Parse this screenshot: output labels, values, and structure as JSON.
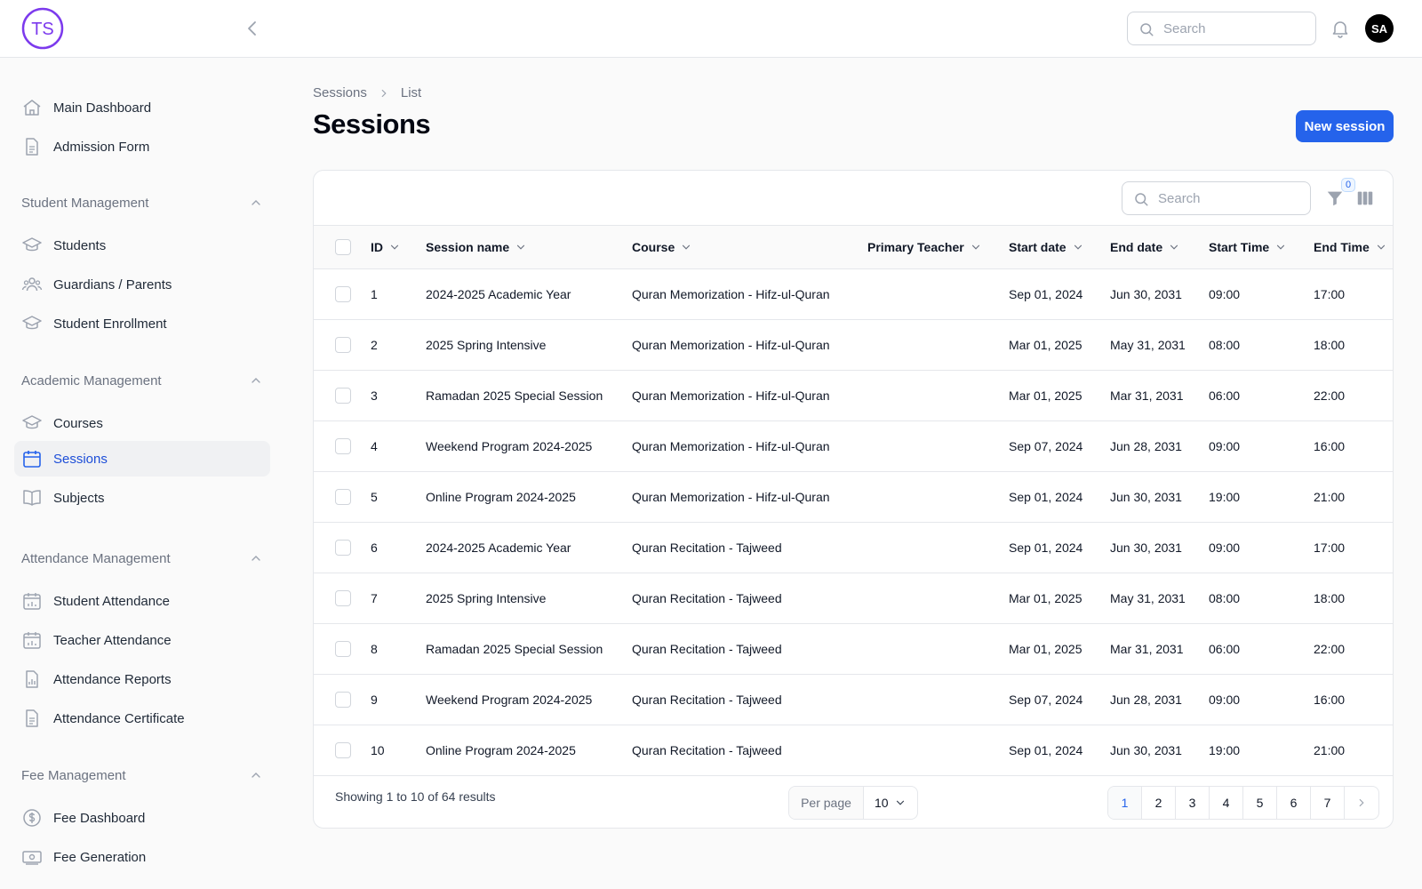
{
  "header": {
    "logo_text": "TS",
    "search_placeholder": "Search",
    "avatar_initials": "SA"
  },
  "sidebar": {
    "top_items": [
      {
        "label": "Main Dashboard",
        "icon": "home-icon"
      },
      {
        "label": "Admission Form",
        "icon": "document-icon"
      }
    ],
    "groups": [
      {
        "title": "Student Management",
        "items": [
          {
            "label": "Students",
            "icon": "graduation-cap-icon"
          },
          {
            "label": "Guardians / Parents",
            "icon": "users-icon"
          },
          {
            "label": "Student Enrollment",
            "icon": "graduation-cap-icon"
          }
        ]
      },
      {
        "title": "Academic Management",
        "items": [
          {
            "label": "Courses",
            "icon": "graduation-cap-icon"
          },
          {
            "label": "Sessions",
            "icon": "calendar-icon",
            "active": true
          },
          {
            "label": "Subjects",
            "icon": "book-icon"
          }
        ]
      },
      {
        "title": "Attendance Management",
        "items": [
          {
            "label": "Student Attendance",
            "icon": "calendar-chart-icon"
          },
          {
            "label": "Teacher Attendance",
            "icon": "calendar-chart-icon"
          },
          {
            "label": "Attendance Reports",
            "icon": "report-icon"
          },
          {
            "label": "Attendance Certificate",
            "icon": "document-icon"
          }
        ]
      },
      {
        "title": "Fee Management",
        "items": [
          {
            "label": "Fee Dashboard",
            "icon": "dollar-icon"
          },
          {
            "label": "Fee Generation",
            "icon": "banknote-icon"
          }
        ]
      }
    ]
  },
  "breadcrumb": {
    "root": "Sessions",
    "current": "List"
  },
  "page": {
    "title": "Sessions",
    "new_button": "New session"
  },
  "table_toolbar": {
    "search_placeholder": "Search",
    "filter_count": "0"
  },
  "table": {
    "columns": [
      "ID",
      "Session name",
      "Course",
      "Primary Teacher",
      "Start date",
      "End date",
      "Start Time",
      "End Time"
    ],
    "rows": [
      [
        "1",
        "2024-2025 Academic Year",
        "Quran Memorization - Hifz-ul-Quran",
        "",
        "Sep 01, 2024",
        "Jun 30, 2031",
        "09:00",
        "17:00"
      ],
      [
        "2",
        "2025 Spring Intensive",
        "Quran Memorization - Hifz-ul-Quran",
        "",
        "Mar 01, 2025",
        "May 31, 2031",
        "08:00",
        "18:00"
      ],
      [
        "3",
        "Ramadan 2025 Special Session",
        "Quran Memorization - Hifz-ul-Quran",
        "",
        "Mar 01, 2025",
        "Mar 31, 2031",
        "06:00",
        "22:00"
      ],
      [
        "4",
        "Weekend Program 2024-2025",
        "Quran Memorization - Hifz-ul-Quran",
        "",
        "Sep 07, 2024",
        "Jun 28, 2031",
        "09:00",
        "16:00"
      ],
      [
        "5",
        "Online Program 2024-2025",
        "Quran Memorization - Hifz-ul-Quran",
        "",
        "Sep 01, 2024",
        "Jun 30, 2031",
        "19:00",
        "21:00"
      ],
      [
        "6",
        "2024-2025 Academic Year",
        "Quran Recitation - Tajweed",
        "",
        "Sep 01, 2024",
        "Jun 30, 2031",
        "09:00",
        "17:00"
      ],
      [
        "7",
        "2025 Spring Intensive",
        "Quran Recitation - Tajweed",
        "",
        "Mar 01, 2025",
        "May 31, 2031",
        "08:00",
        "18:00"
      ],
      [
        "8",
        "Ramadan 2025 Special Session",
        "Quran Recitation - Tajweed",
        "",
        "Mar 01, 2025",
        "Mar 31, 2031",
        "06:00",
        "22:00"
      ],
      [
        "9",
        "Weekend Program 2024-2025",
        "Quran Recitation - Tajweed",
        "",
        "Sep 07, 2024",
        "Jun 28, 2031",
        "09:00",
        "16:00"
      ],
      [
        "10",
        "Online Program 2024-2025",
        "Quran Recitation - Tajweed",
        "",
        "Sep 01, 2024",
        "Jun 30, 2031",
        "19:00",
        "21:00"
      ]
    ]
  },
  "footer": {
    "showing": "Showing 1 to 10 of 64 results",
    "per_page_label": "Per page",
    "per_page_value": "10",
    "pages": [
      "1",
      "2",
      "3",
      "4",
      "5",
      "6",
      "7"
    ],
    "current_page": "1"
  },
  "colors": {
    "accent": "#2563eb",
    "logo": "#7c3aed"
  }
}
